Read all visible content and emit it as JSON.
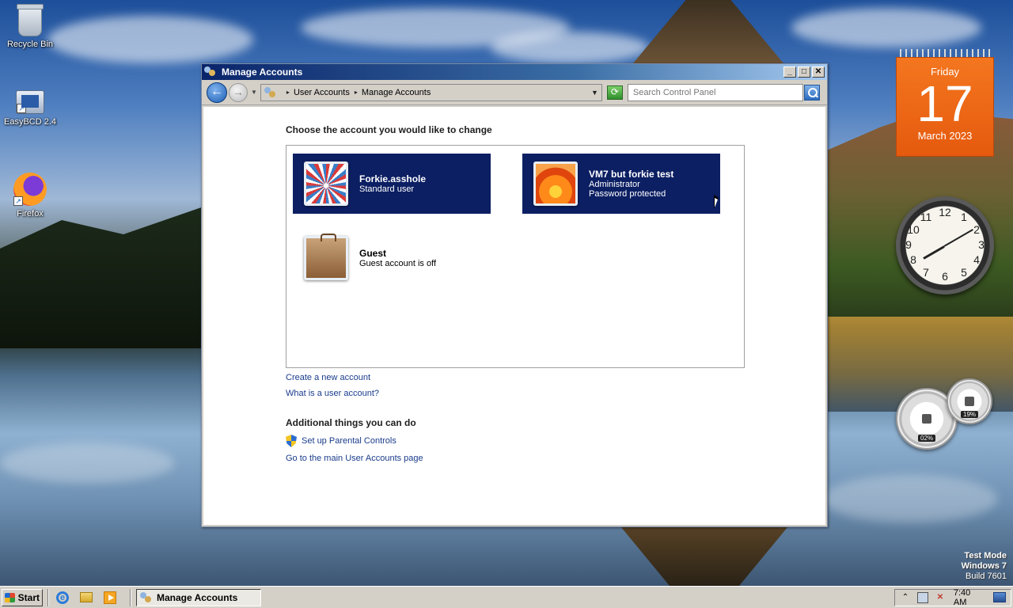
{
  "desktop": {
    "icons": [
      {
        "label": "Recycle Bin",
        "icon": "recycle-bin-icon"
      },
      {
        "label": "EasyBCD 2.4",
        "icon": "easybcd-icon"
      },
      {
        "label": "Firefox",
        "icon": "firefox-icon"
      }
    ],
    "calendar": {
      "weekday": "Friday",
      "day": "17",
      "month_year": "March 2023"
    },
    "clock": {
      "numbers": [
        "12",
        "1",
        "2",
        "3",
        "4",
        "5",
        "6",
        "7",
        "8",
        "9",
        "10",
        "11"
      ]
    },
    "meters": {
      "cpu": "02%",
      "memory": "19%"
    },
    "watermark": {
      "line1": "Test Mode",
      "line2": "Windows 7",
      "line3": "Build 7601"
    }
  },
  "window": {
    "title": "Manage Accounts",
    "controls": {
      "minimize": "_",
      "maximize": "□",
      "close": "✕"
    },
    "breadcrumb": [
      "User Accounts",
      "Manage Accounts"
    ],
    "search_placeholder": "Search Control Panel",
    "heading": "Choose the account you would like to change",
    "accounts": [
      {
        "name": "Forkie.asshole",
        "line1": "Standard user",
        "line2": "",
        "picture": "windmill-picture"
      },
      {
        "name": "VM7 but forkie test",
        "line1": "Administrator",
        "line2": "Password protected",
        "picture": "flower-picture"
      },
      {
        "name": "Guest",
        "line1": "Guest account is off",
        "line2": "",
        "picture": "briefcase-picture"
      }
    ],
    "links": {
      "create": "Create a new account",
      "what_is": "What is a user account?"
    },
    "additional": {
      "heading": "Additional things you can do",
      "parental": "Set up Parental Controls",
      "main_page": "Go to the main User Accounts page"
    }
  },
  "taskbar": {
    "start_label": "Start",
    "task_label": "Manage Accounts",
    "time": "7:40 AM"
  },
  "colors": {
    "selected_account": "#0c1f63",
    "link": "#1a3c8c",
    "calendar": "#f4761f"
  }
}
